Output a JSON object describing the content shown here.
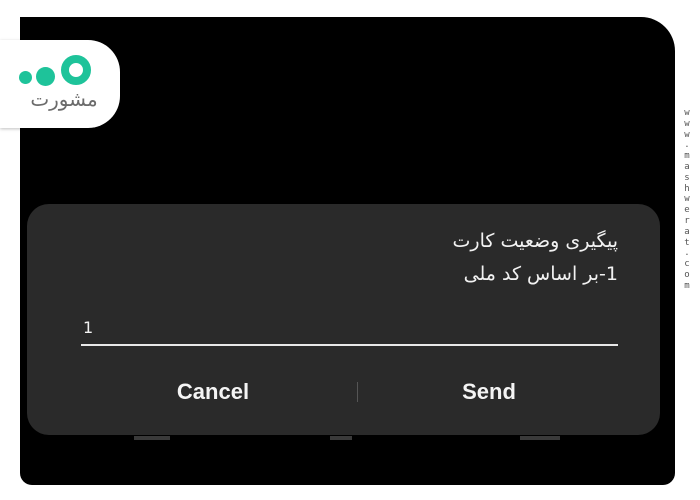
{
  "logo": {
    "word": "مشورت"
  },
  "watermark": {
    "text": "www.mashwerat.com"
  },
  "dialog": {
    "title": "پیگیری وضعیت کارت",
    "subtitle": "1-بر اساس کد ملی",
    "input_value": "1",
    "cancel_label": "Cancel",
    "send_label": "Send"
  },
  "colors": {
    "screen_background": "#000000",
    "dialog_background": "#2a2a2a",
    "logo_accent": "#1ec39a",
    "text": "#f2f2f2"
  }
}
